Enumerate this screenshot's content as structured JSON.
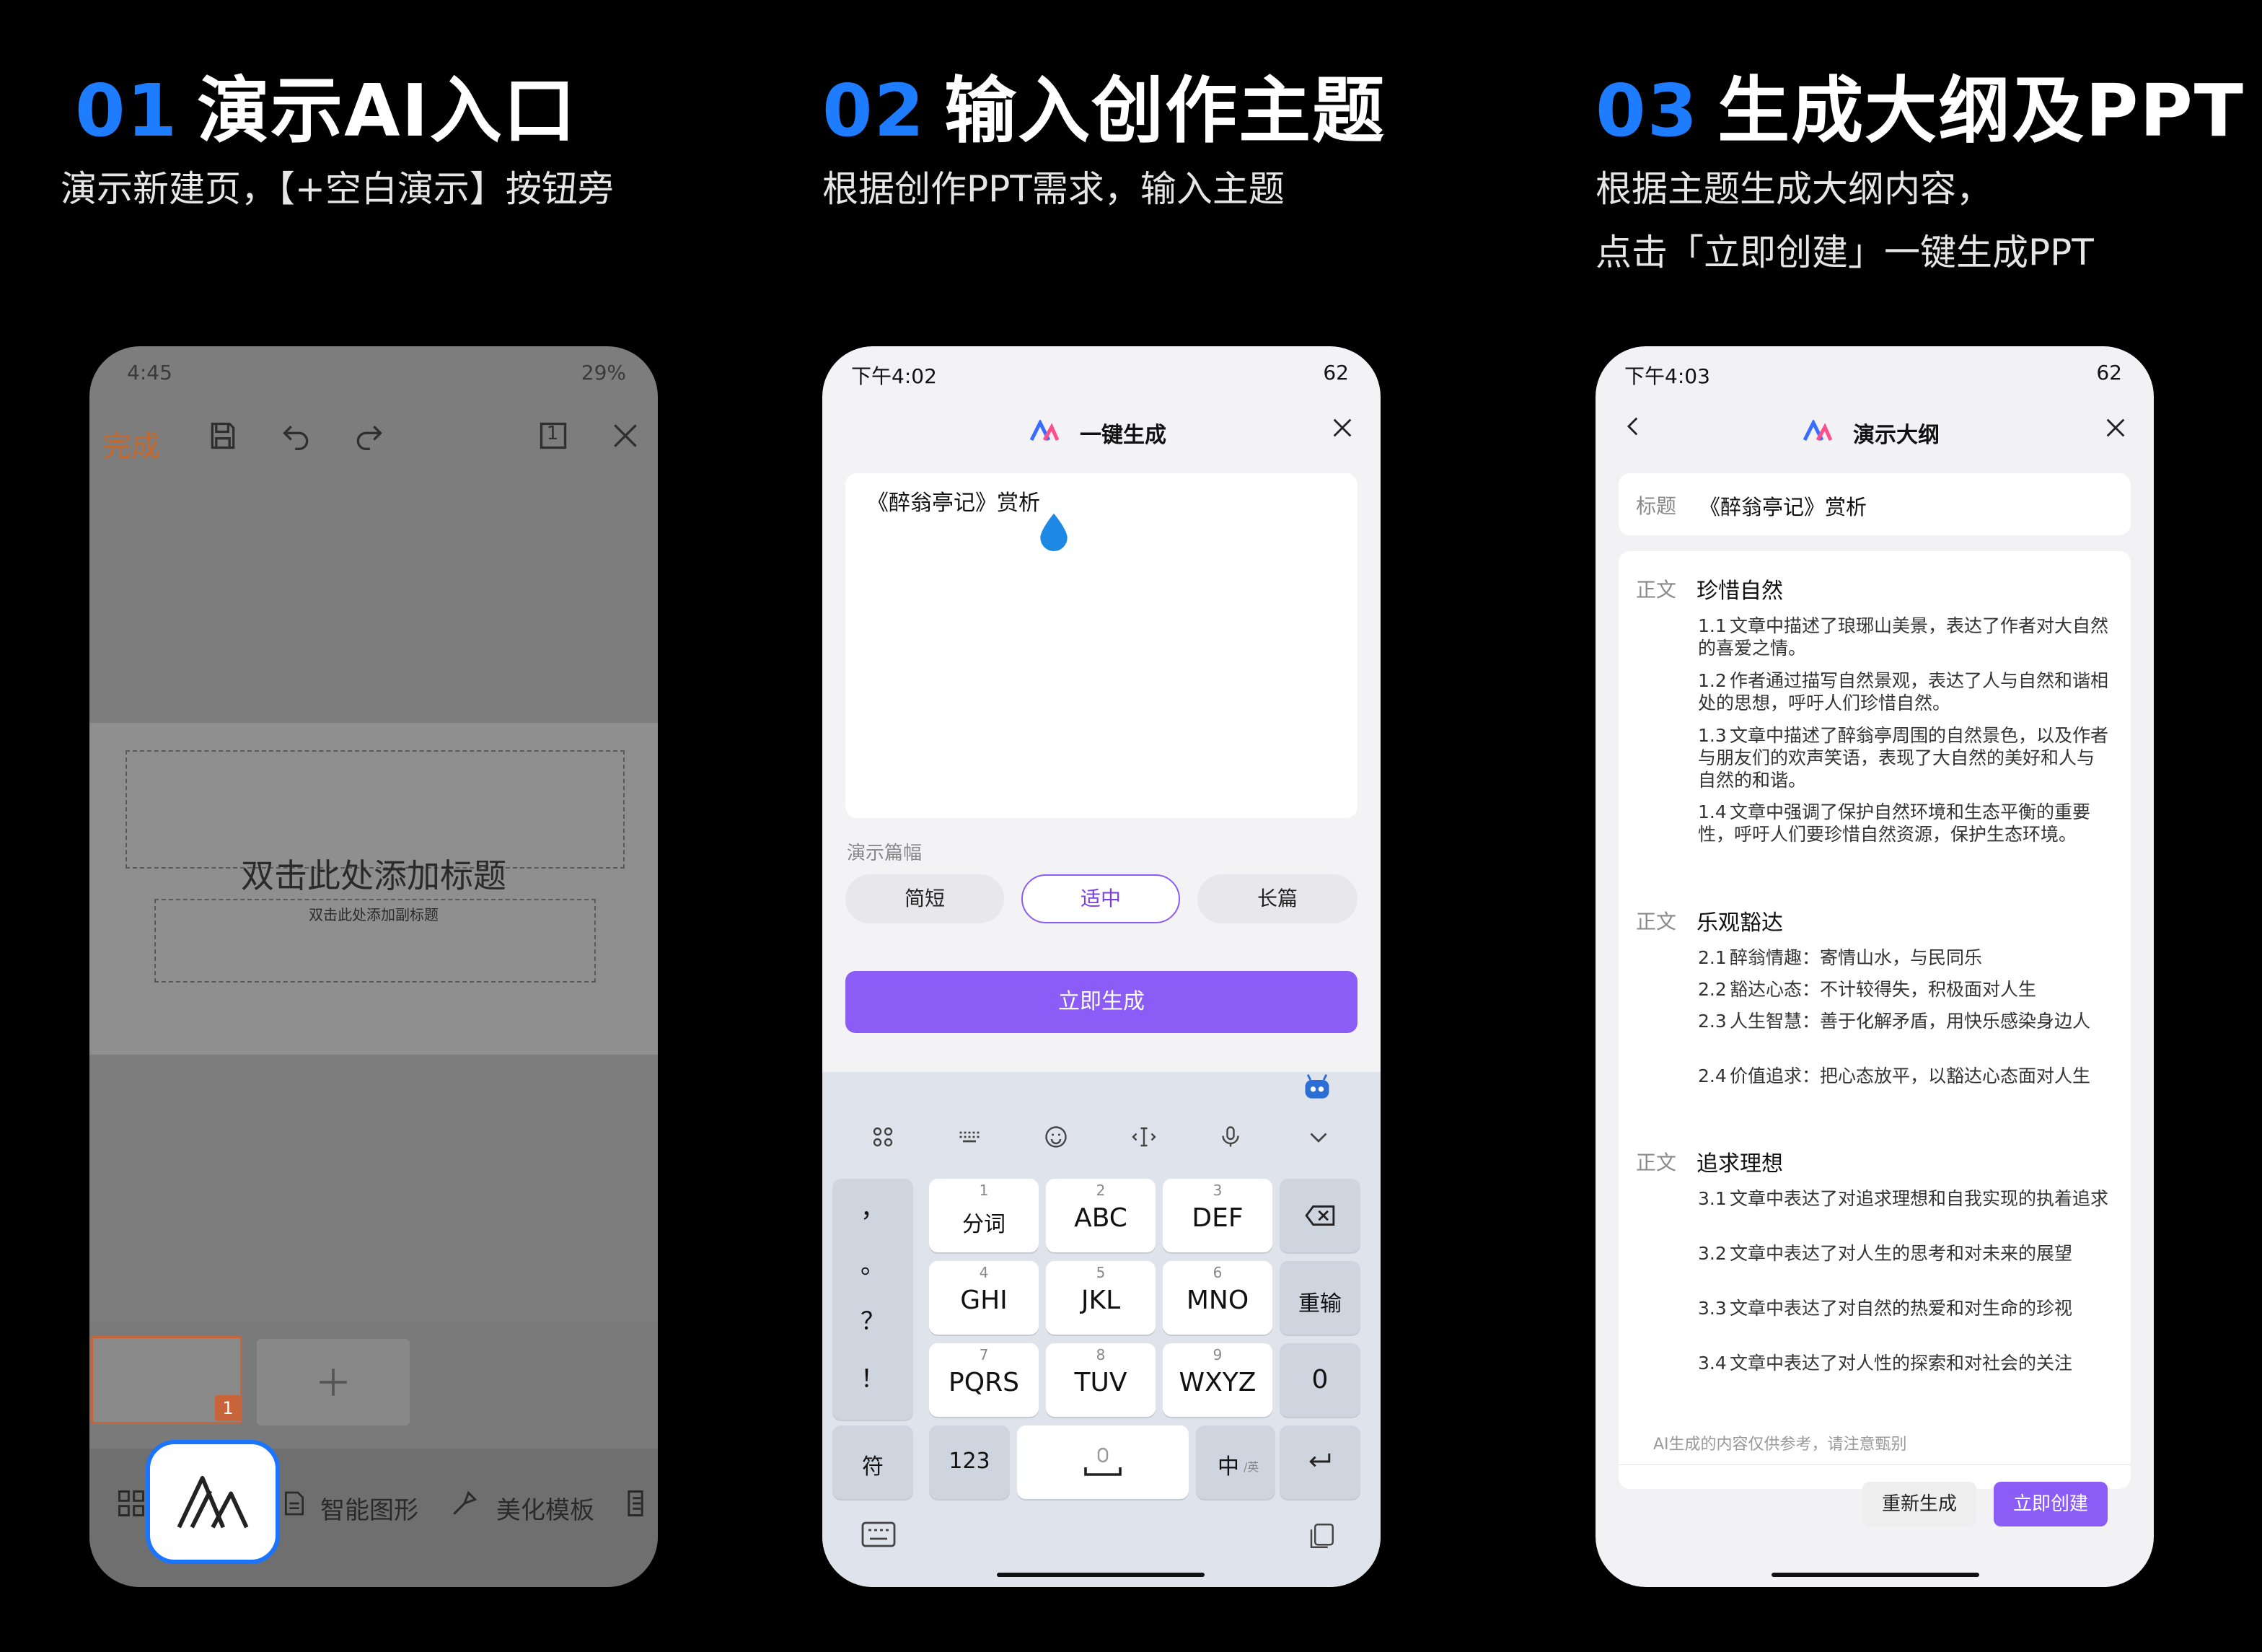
{
  "step1": {
    "num": "01",
    "title": "演示AI入口",
    "subtitle": "演示新建页，【+空白演示】按钮旁",
    "phone": {
      "time": "4:45",
      "battery": "29%",
      "done": "完成",
      "page_indicator": "1",
      "slide_title": "双击此处添加标题",
      "slide_subtitle": "双击此处添加副标题",
      "thumb_number": "1",
      "bottom_items": [
        "智能图形",
        "美化模板"
      ]
    }
  },
  "step2": {
    "num": "02",
    "title": "输入创作主题",
    "subtitle": "根据创作PPT需求，输入主题",
    "phone": {
      "time": "下午4:02",
      "battery": "62",
      "header": "一键生成",
      "input_value": "《醉翁亭记》赏析",
      "length_label": "演示篇幅",
      "length_options": [
        "简短",
        "适中",
        "长篇"
      ],
      "selected_option": "适中",
      "generate": "立即生成",
      "keys": {
        "row1": [
          {
            "n": "1",
            "l": "分词"
          },
          {
            "n": "2",
            "l": "ABC"
          },
          {
            "n": "3",
            "l": "DEF"
          }
        ],
        "row2": [
          {
            "n": "4",
            "l": "GHI"
          },
          {
            "n": "5",
            "l": "JKL"
          },
          {
            "n": "6",
            "l": "MNO"
          }
        ],
        "row3": [
          {
            "n": "7",
            "l": "PQRS"
          },
          {
            "n": "8",
            "l": "TUV"
          },
          {
            "n": "9",
            "l": "WXYZ"
          }
        ],
        "punct": [
          "，",
          "。",
          "？",
          "！"
        ],
        "reenter": "重输",
        "zero": "0",
        "symbol": "符",
        "num123": "123",
        "lang": "中",
        "lang_small": "/英"
      }
    }
  },
  "step3": {
    "num": "03",
    "title": "生成大纲及PPT",
    "subtitle_line1": "根据主题生成大纲内容，",
    "subtitle_line2": "点击「立即创建」一键生成PPT",
    "phone": {
      "time": "下午4:03",
      "battery": "62",
      "header": "演示大纲",
      "title_label": "标题",
      "title_value": "《醉翁亭记》赏析",
      "section_label": "正文",
      "sections": [
        {
          "title": "珍惜自然",
          "items": [
            {
              "n": "1.1",
              "t": "文章中描述了琅琊山美景，表达了作者对大自然的喜爱之情。"
            },
            {
              "n": "1.2",
              "t": "作者通过描写自然景观，表达了人与自然和谐相处的思想，呼吁人们珍惜自然。"
            },
            {
              "n": "1.3",
              "t": "文章中描述了醉翁亭周围的自然景色，以及作者与朋友们的欢声笑语，表现了大自然的美好和人与自然的和谐。"
            },
            {
              "n": "1.4",
              "t": "文章中强调了保护自然环境和生态平衡的重要性，呼吁人们要珍惜自然资源，保护生态环境。"
            }
          ]
        },
        {
          "title": "乐观豁达",
          "items": [
            {
              "n": "2.1",
              "t": "醉翁情趣：寄情山水，与民同乐"
            },
            {
              "n": "2.2",
              "t": "豁达心态：不计较得失，积极面对人生"
            },
            {
              "n": "2.3",
              "t": "人生智慧：善于化解矛盾，用快乐感染身边人"
            },
            {
              "n": "2.4",
              "t": "价值追求：把心态放平，以豁达心态面对人生"
            }
          ]
        },
        {
          "title": "追求理想",
          "items": [
            {
              "n": "3.1",
              "t": "文章中表达了对追求理想和自我实现的执着追求"
            },
            {
              "n": "3.2",
              "t": "文章中表达了对人生的思考和对未来的展望"
            },
            {
              "n": "3.3",
              "t": "文章中表达了对自然的热爱和对生命的珍视"
            },
            {
              "n": "3.4",
              "t": "文章中表达了对人性的探索和对社会的关注"
            }
          ]
        }
      ],
      "disclaimer": "AI生成的内容仅供参考，请注意甄别",
      "regenerate": "重新生成",
      "create": "立即创建"
    }
  },
  "colors": {
    "accent_blue": "#1d7cff",
    "purple": "#8b5cf6",
    "orange": "#c7692a"
  }
}
